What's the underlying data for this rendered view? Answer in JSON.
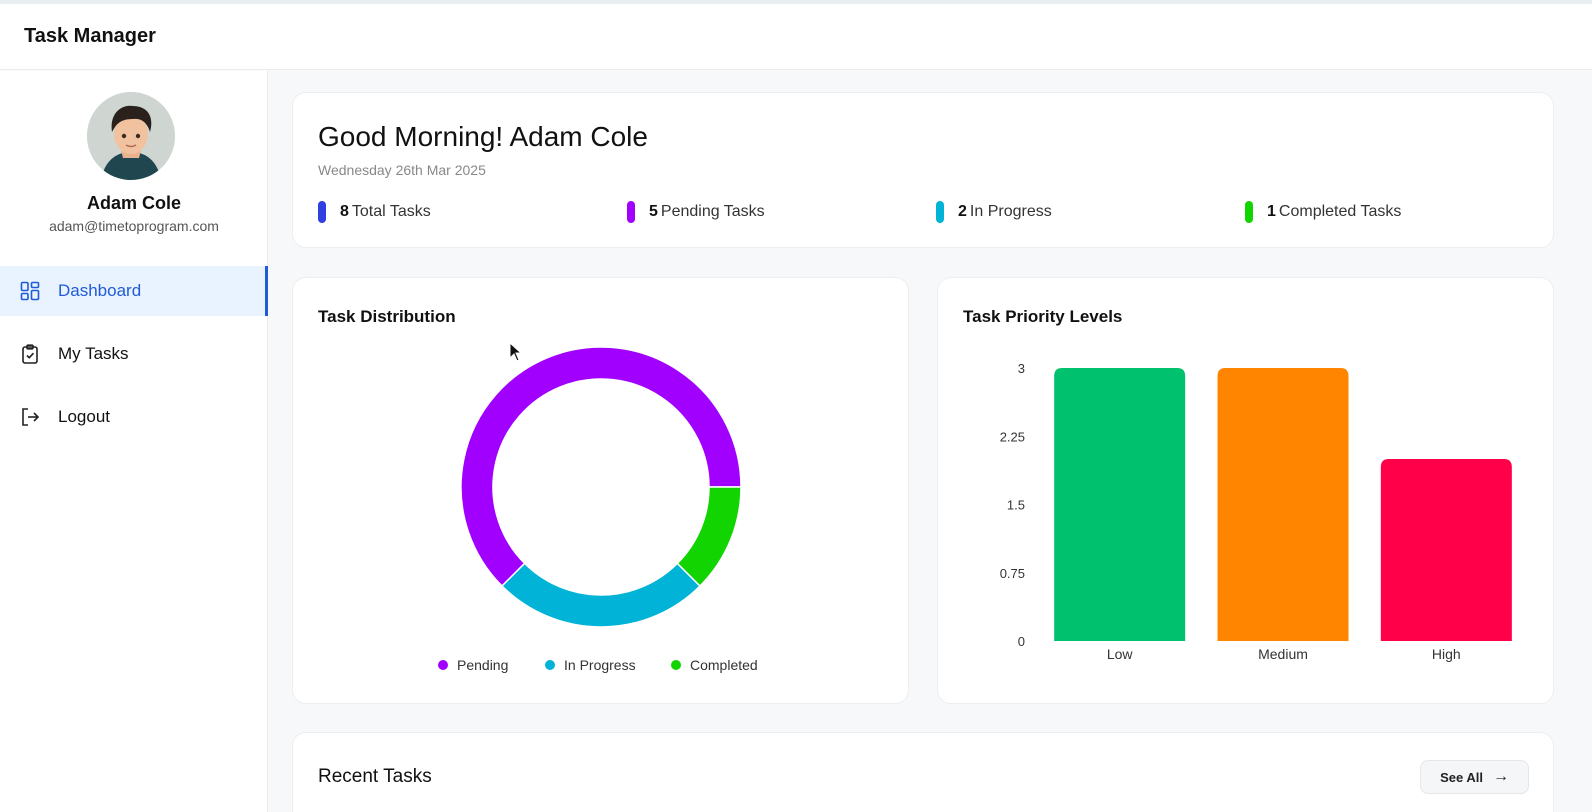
{
  "header": {
    "title": "Task Manager"
  },
  "user": {
    "name": "Adam Cole",
    "email": "adam@timetoprogram.com"
  },
  "nav": {
    "dashboard": "Dashboard",
    "tasks": "My Tasks",
    "logout": "Logout",
    "active_color": "#1f5bd6"
  },
  "greeting": {
    "title": "Good Morning! Adam Cole",
    "date": "Wednesday 26th Mar 2025"
  },
  "stats": [
    {
      "count": "8",
      "label": "Total Tasks",
      "color": "#2f3fe0"
    },
    {
      "count": "5",
      "label": "Pending Tasks",
      "color": "#a100ff"
    },
    {
      "count": "2",
      "label": "In Progress",
      "color": "#00b3d7"
    },
    {
      "count": "1",
      "label": "Completed Tasks",
      "color": "#11d400"
    }
  ],
  "distribution": {
    "title": "Task Distribution"
  },
  "priority": {
    "title": "Task Priority Levels"
  },
  "recent": {
    "title": "Recent Tasks",
    "see_all": "See All"
  },
  "chart_data": [
    {
      "type": "pie",
      "title": "Task Distribution",
      "donut": true,
      "labels": [
        "Pending",
        "In Progress",
        "Completed"
      ],
      "values": [
        5,
        2,
        1
      ],
      "colors": [
        "#a100ff",
        "#00b3d7",
        "#11d400"
      ],
      "legend": "bottom"
    },
    {
      "type": "bar",
      "title": "Task Priority Levels",
      "categories": [
        "Low",
        "Medium",
        "High"
      ],
      "values": [
        3,
        3,
        2
      ],
      "colors": [
        "#00c26e",
        "#ff8500",
        "#ff0049"
      ],
      "ylim": [
        0,
        3
      ],
      "yticks": [
        "3",
        "2.25",
        "1.5",
        "0.75",
        "0"
      ],
      "ytick_values": [
        3,
        2.25,
        1.5,
        0.75,
        0
      ],
      "grid": false
    }
  ]
}
